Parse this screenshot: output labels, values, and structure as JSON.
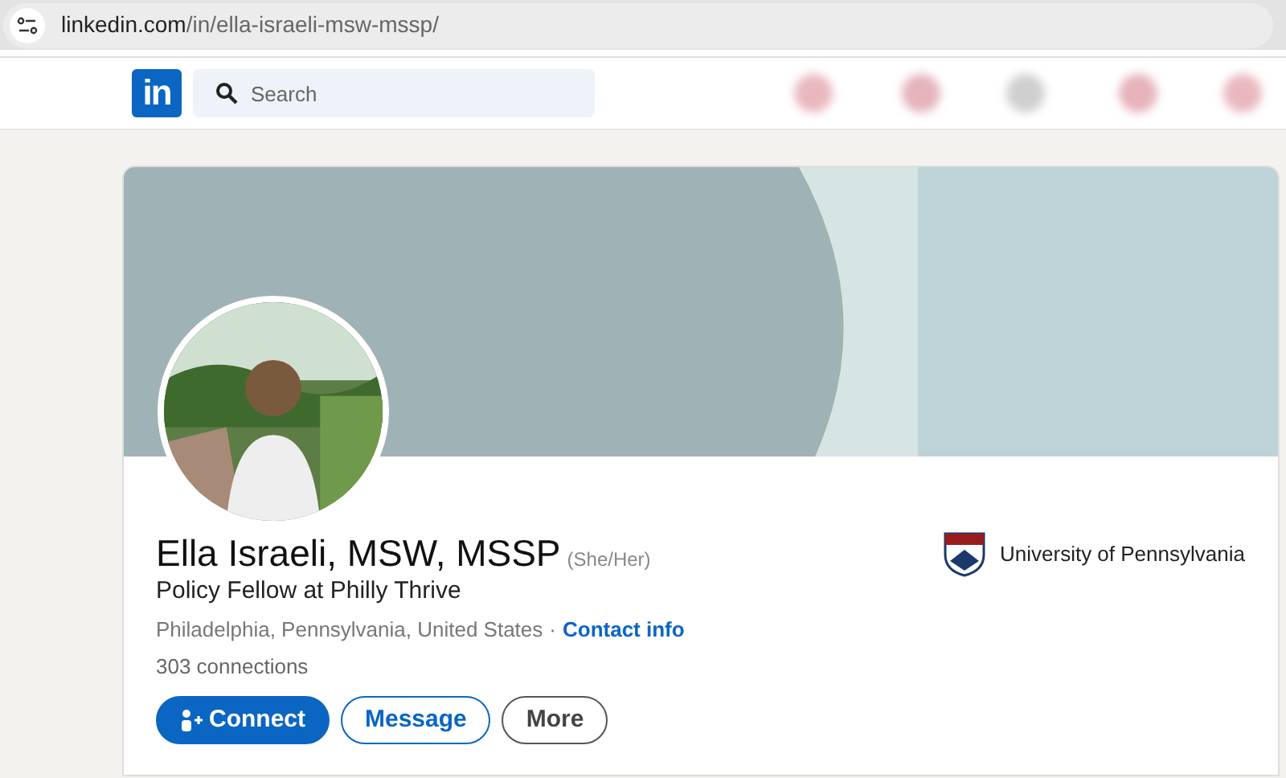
{
  "browser": {
    "url_host": "linkedin.com",
    "url_path": "/in/ella-israeli-msw-mssp/"
  },
  "nav": {
    "logo": "in",
    "search": {
      "placeholder": "Search"
    }
  },
  "profile": {
    "name": "Ella Israeli, MSW, MSSP",
    "pronouns": "(She/Her)",
    "headline": "Policy Fellow at Philly Thrive",
    "location": "Philadelphia, Pennsylvania, United States",
    "separator": "·",
    "contact_link": "Contact info",
    "connections": "303 connections",
    "education": "University of Pennsylvania",
    "buttons": [
      {
        "kind": "primary",
        "label": "Connect"
      },
      {
        "kind": "outline",
        "label": "Message"
      },
      {
        "kind": "secondary",
        "label": "More"
      }
    ]
  }
}
